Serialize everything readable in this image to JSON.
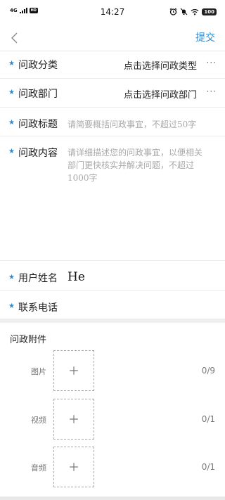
{
  "status_bar": {
    "network": "4G",
    "hd_badge": "HD",
    "time": "14:27",
    "battery": "100"
  },
  "nav": {
    "submit_label": "提交"
  },
  "form": {
    "category": {
      "label": "问政分类",
      "value": "点击选择问政类型",
      "more": "···"
    },
    "department": {
      "label": "问政部门",
      "value": "点击选择问政部门",
      "more": "···"
    },
    "title": {
      "label": "问政标题",
      "placeholder": "请简要概括问政事宜，不超过50字"
    },
    "content": {
      "label": "问政内容",
      "placeholder": "请详细描述您的问政事宜，以便相关部门更快核实并解决问题，不超过1000字"
    },
    "user_name": {
      "label": "用户姓名",
      "value": "He"
    },
    "phone": {
      "label": "联系电话"
    }
  },
  "attachments": {
    "title": "问政附件",
    "items": [
      {
        "label": "图片",
        "count": "0/9"
      },
      {
        "label": "视频",
        "count": "0/1"
      },
      {
        "label": "音频",
        "count": "0/1"
      }
    ]
  }
}
